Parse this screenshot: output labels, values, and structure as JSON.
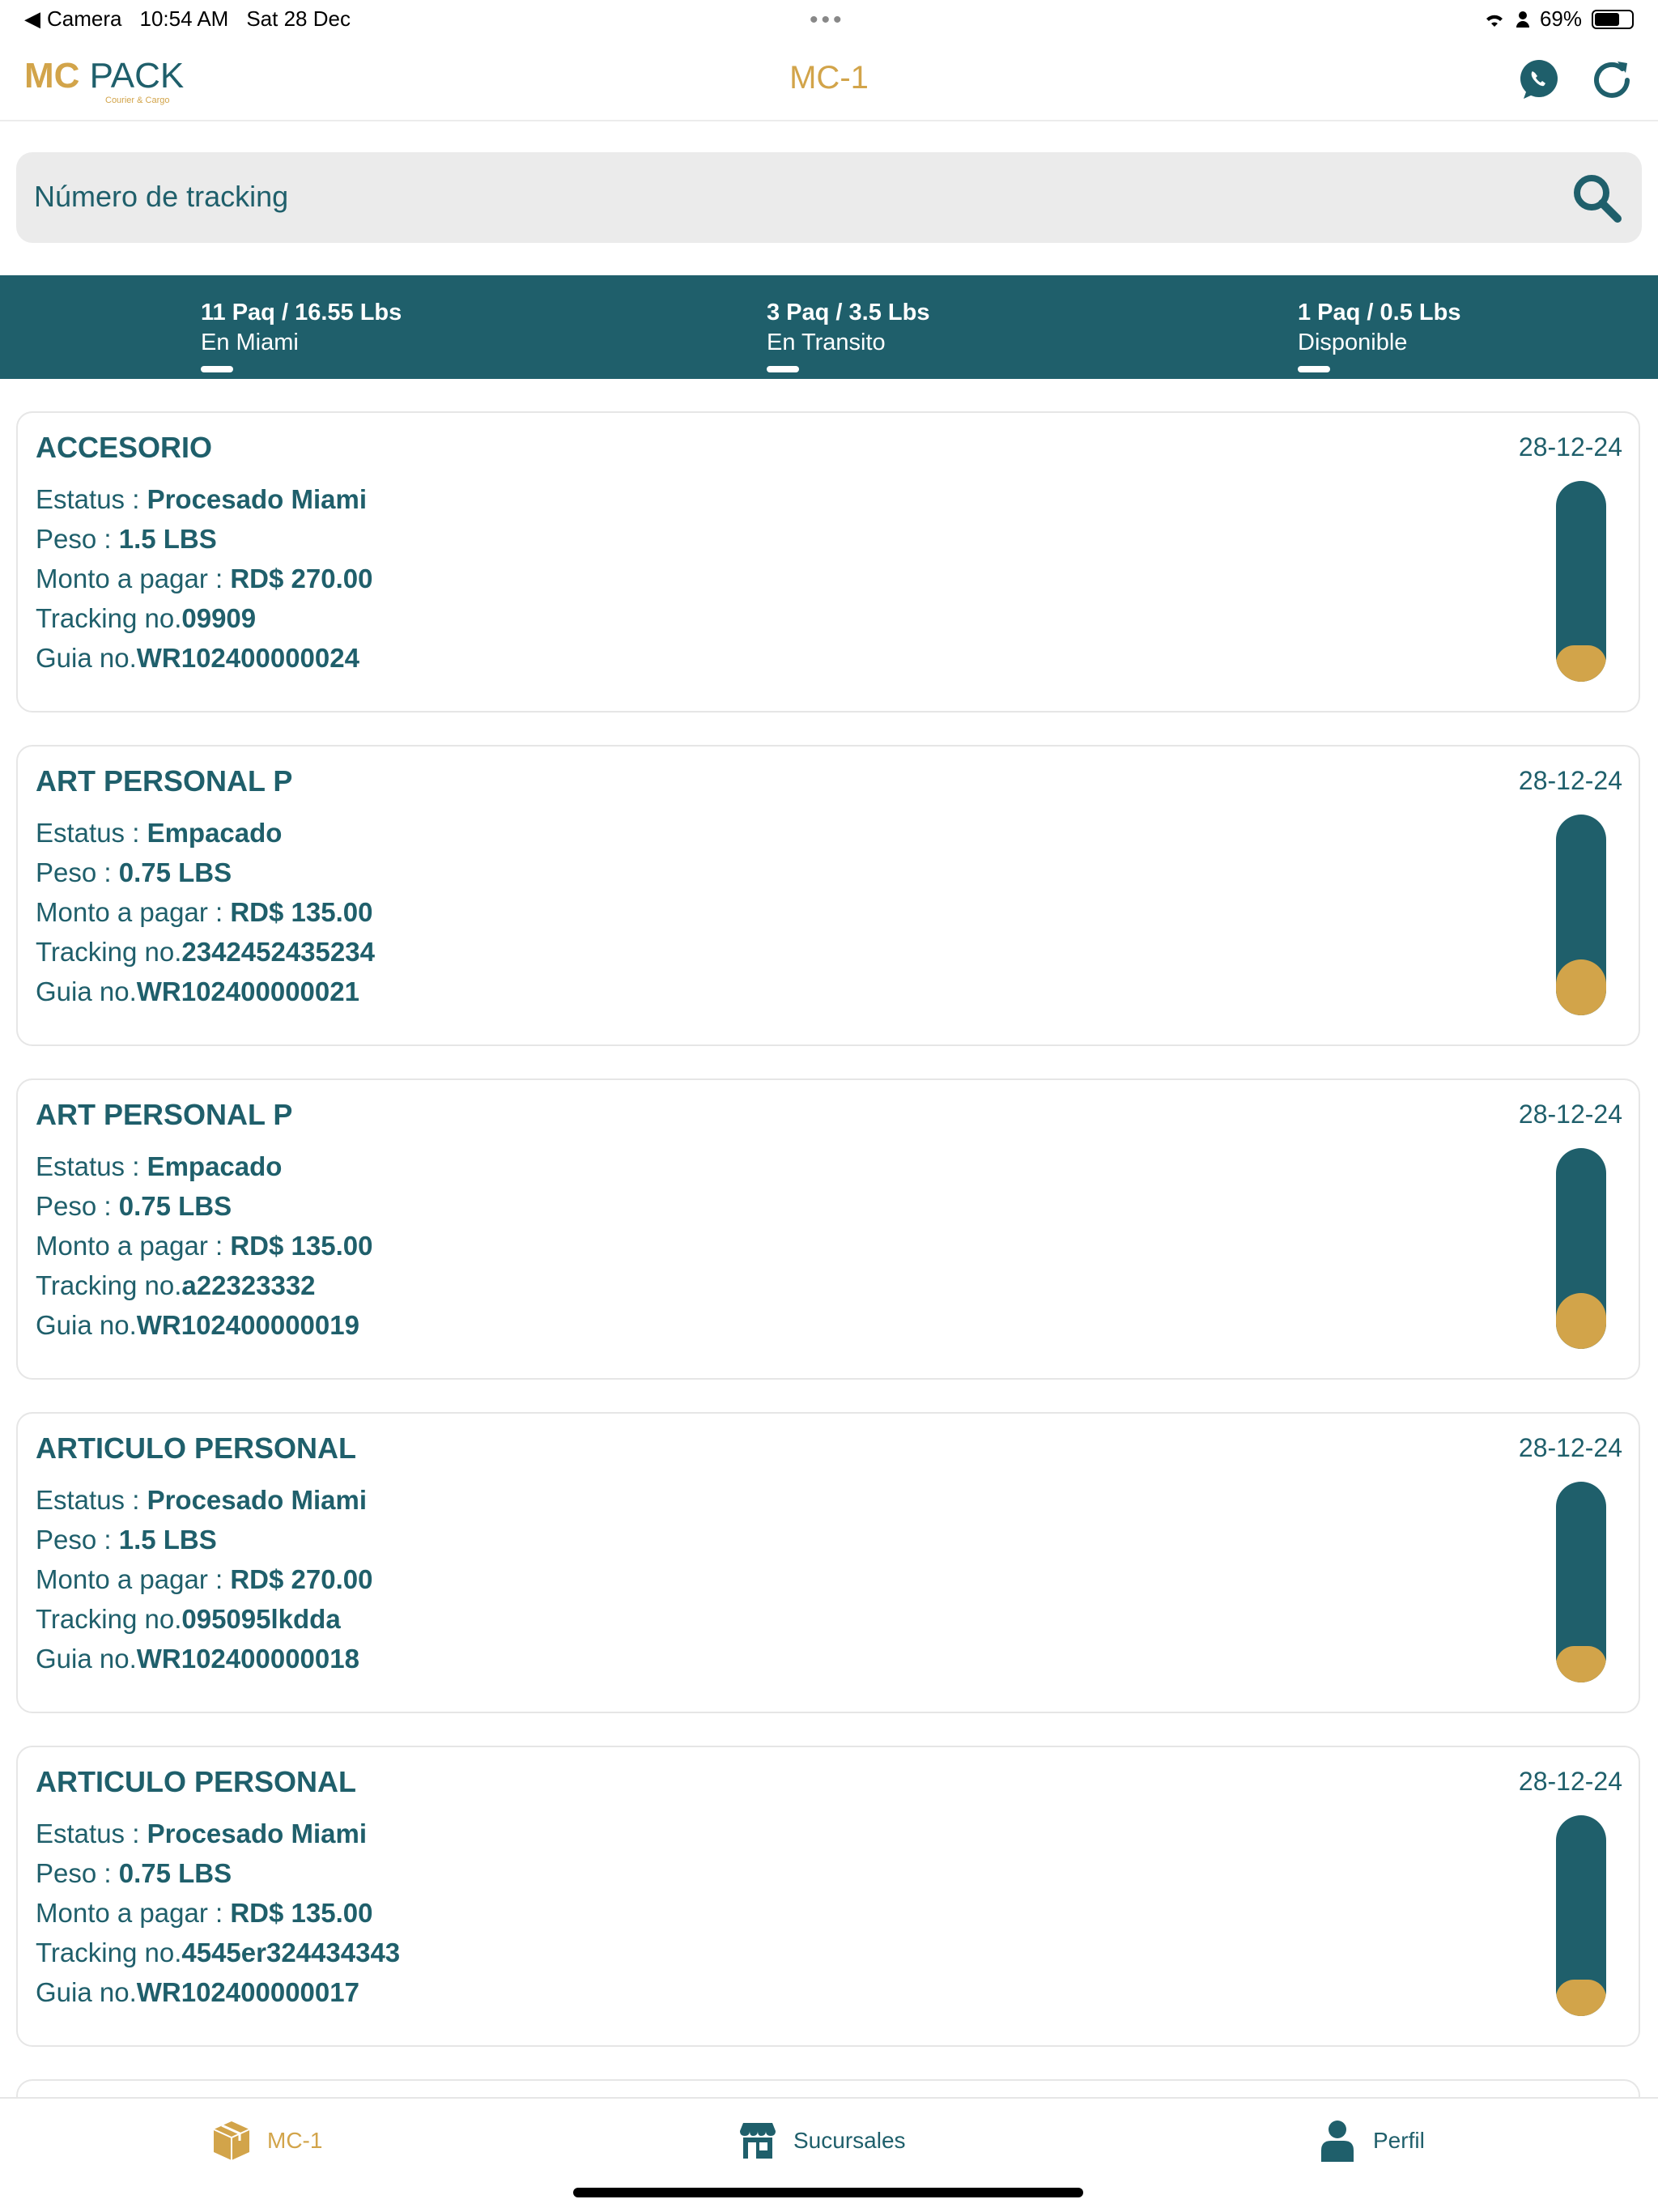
{
  "status_bar": {
    "back_label": "Camera",
    "time": "10:54 AM",
    "date": "Sat 28 Dec",
    "battery": "69%",
    "battery_level": 0.69
  },
  "header": {
    "logo_mc": "MC",
    "logo_pack": "PACK",
    "logo_sub": "Courier & Cargo",
    "title": "MC-1",
    "icons": [
      "whatsapp-icon",
      "refresh-icon"
    ]
  },
  "search": {
    "placeholder": "Número de tracking",
    "icon": "search-icon"
  },
  "summary": [
    {
      "count": "11 Paq / 16.55 Lbs",
      "label": "En Miami"
    },
    {
      "count": "3 Paq / 3.5 Lbs",
      "label": "En Transito"
    },
    {
      "count": "1 Paq / 0.5 Lbs",
      "label": "Disponible"
    }
  ],
  "labels": {
    "estatus": "Estatus : ",
    "peso": "Peso : ",
    "monto": "Monto a pagar :  ",
    "tracking": "Tracking no.",
    "guia": "Guia no."
  },
  "packages": [
    {
      "name": "ACCESORIO",
      "date": "28-12-24",
      "status": "Procesado Miami",
      "weight": "1.5 LBS",
      "amount": "RD$ 270.00",
      "tracking": "09909",
      "guia": "WR102400000024",
      "progress": 0.18
    },
    {
      "name": "ART PERSONAL P",
      "date": "28-12-24",
      "status": "Empacado",
      "weight": "0.75 LBS",
      "amount": "RD$ 135.00",
      "tracking": "2342452435234",
      "guia": "WR102400000021",
      "progress": 0.28
    },
    {
      "name": "ART PERSONAL P",
      "date": "28-12-24",
      "status": "Empacado",
      "weight": "0.75 LBS",
      "amount": "RD$ 135.00",
      "tracking": "a22323332",
      "guia": "WR102400000019",
      "progress": 0.28
    },
    {
      "name": "ARTICULO PERSONAL",
      "date": "28-12-24",
      "status": "Procesado Miami",
      "weight": "1.5 LBS",
      "amount": "RD$ 270.00",
      "tracking": "095095lkdda",
      "guia": "WR102400000018",
      "progress": 0.18
    },
    {
      "name": "ARTICULO PERSONAL",
      "date": "28-12-24",
      "status": "Procesado Miami",
      "weight": "0.75 LBS",
      "amount": "RD$ 135.00",
      "tracking": "4545er324434343",
      "guia": "WR102400000017",
      "progress": 0.18
    }
  ],
  "bottom_nav": [
    {
      "label": "MC-1",
      "icon": "package-icon",
      "active": true
    },
    {
      "label": "Sucursales",
      "icon": "store-icon",
      "active": false
    },
    {
      "label": "Perfil",
      "icon": "user-icon",
      "active": false
    }
  ],
  "colors": {
    "primary": "#1f5f6b",
    "accent": "#d2a44a",
    "search_bg": "#ebebeb"
  }
}
